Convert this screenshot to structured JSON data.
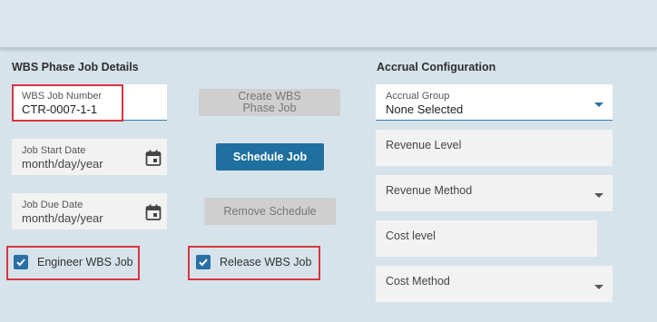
{
  "wbs_section": {
    "title": "WBS Phase Job Details",
    "job_number": {
      "label": "WBS Job Number",
      "value": "CTR-0007-1-1"
    },
    "start_date": {
      "label": "Job Start Date",
      "placeholder": "month/day/year"
    },
    "due_date": {
      "label": "Job Due Date",
      "placeholder": "month/day/year"
    },
    "engineer_checkbox": {
      "label": "Engineer WBS Job",
      "checked": true
    },
    "release_checkbox": {
      "label": "Release WBS Job",
      "checked": true
    }
  },
  "actions": {
    "create_label": "Create WBS Phase Job",
    "schedule_label": "Schedule Job",
    "remove_label": "Remove Schedule"
  },
  "accrual_section": {
    "title": "Accrual Configuration",
    "accrual_group": {
      "label": "Accrual Group",
      "value": "None Selected"
    },
    "revenue_level": "Revenue Level",
    "revenue_method": "Revenue Method",
    "cost_level": "Cost level",
    "cost_method": "Cost Method"
  },
  "colors": {
    "primary": "#1f6f9f",
    "highlight": "#d9363e",
    "background": "#d6e3ea"
  }
}
